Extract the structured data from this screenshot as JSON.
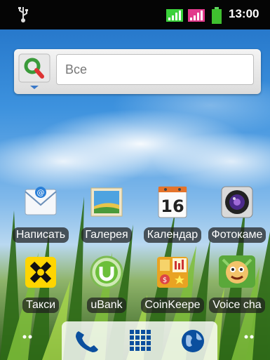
{
  "status_bar": {
    "time": "13:00",
    "icons": [
      "usb-icon",
      "signal-icon",
      "signal-icon",
      "battery-icon"
    ]
  },
  "search_widget": {
    "placeholder": "Все",
    "icons": [
      "google-search-icon"
    ]
  },
  "apps_row1": [
    {
      "label": "Написать",
      "icon": "email-icon"
    },
    {
      "label": "Галерея",
      "icon": "gallery-icon"
    },
    {
      "label": "Календар",
      "icon": "calendar-icon",
      "date": "16"
    },
    {
      "label": "Фотокаме",
      "icon": "camera-icon"
    }
  ],
  "apps_row2": [
    {
      "label": "Такси",
      "icon": "taxi-icon"
    },
    {
      "label": "uBank",
      "icon": "ubank-icon"
    },
    {
      "label": "CoinKeepe",
      "icon": "coinkeeper-icon"
    },
    {
      "label": "Voice cha",
      "icon": "voice-changer-icon"
    }
  ],
  "dock": {
    "items": [
      "phone-icon",
      "apps-grid-icon",
      "browser-globe-icon"
    ]
  },
  "colors": {
    "status_bar": "#050505",
    "signal_green": "#3bd13b",
    "signal_pink": "#e23a8c",
    "dock_icon_blue": "#0b4f9e"
  }
}
